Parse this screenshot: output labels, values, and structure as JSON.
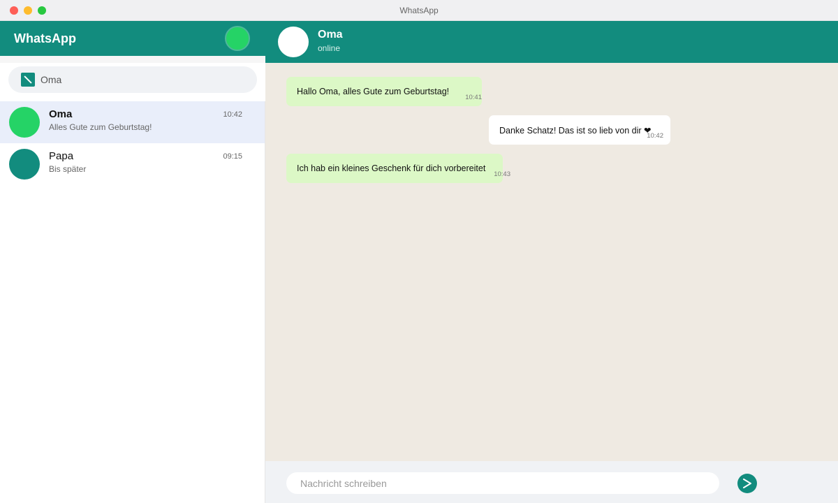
{
  "window": {
    "title": "WhatsApp"
  },
  "sidebar": {
    "app_title": "WhatsApp",
    "search": {
      "value": "Oma",
      "placeholder": ""
    },
    "chats": [
      {
        "name": "Oma",
        "time": "10:42",
        "preview": "Alles Gute zum Geburtstag!",
        "avatar_color": "#25d366",
        "active": true,
        "bold": true
      },
      {
        "name": "Papa",
        "time": "09:15",
        "preview": "Bis später",
        "avatar_color": "#128c7e",
        "active": false,
        "bold": false
      }
    ]
  },
  "chat": {
    "contact_name": "Oma",
    "status": "online",
    "messages": [
      {
        "text": "Hallo Oma, alles Gute zum Geburtstag!",
        "time": "10:41",
        "direction": "outgoing"
      },
      {
        "text": "Danke Schatz! Das ist so lieb von dir ❤",
        "time": "10:42",
        "direction": "incoming"
      },
      {
        "text": "Ich hab ein kleines Geschenk für dich vorbereitet",
        "time": "10:43",
        "direction": "outgoing"
      }
    ],
    "composer": {
      "placeholder": "Nachricht schreiben",
      "value": ""
    }
  },
  "colors": {
    "brand": "#128c7e",
    "accent": "#25d366",
    "outgoing_bubble": "#dcf8c6",
    "incoming_bubble": "#ffffff",
    "chat_background": "#efeae2"
  }
}
